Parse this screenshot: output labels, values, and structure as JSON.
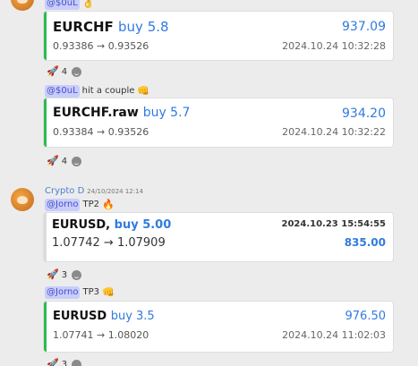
{
  "msg1": {
    "mention": "@$0uL",
    "card": {
      "pair": "EURCHF",
      "side": "buy 5.8",
      "profit": "937.09",
      "entry": "0.93386",
      "exit": "0.93526",
      "arrow": "→",
      "date": "2024.10.24 10:32:28"
    },
    "reactions": {
      "count": "4"
    }
  },
  "msg2": {
    "mention": "@$0uL",
    "text": "hit a couple",
    "card": {
      "pair": "EURCHF.raw",
      "side": "buy 5.7",
      "profit": "934.20",
      "entry": "0.93384",
      "exit": "0.93526",
      "arrow": "→",
      "date": "2024.10.24 10:32:22"
    },
    "reactions": {
      "count": "4"
    }
  },
  "msg3": {
    "username": "Crypto D",
    "timestamp": "24/10/2024 12:14",
    "mention": "@Jorno",
    "text": "TP2",
    "card": {
      "pair": "EURUSD,",
      "side": "buy 5.00",
      "profit": "835.00",
      "entry": "1.07742",
      "exit": "1.07909",
      "arrow": "→",
      "date": "2024.10.23 15:54:55"
    },
    "reactions": {
      "count": "3"
    }
  },
  "msg4": {
    "mention": "@Jorno",
    "text": "TP3",
    "card": {
      "pair": "EURUSD",
      "side": "buy 3.5",
      "profit": "976.50",
      "entry": "1.07741",
      "exit": "1.08020",
      "arrow": "→",
      "date": "2024.10.24 11:02:03"
    },
    "reactions": {
      "count": "3"
    }
  },
  "colors": {
    "accent": "#2f7be0",
    "border": "#2bbb50",
    "mention_bg": "#c9cdfb",
    "mention_fg": "#4450c7"
  },
  "icons": {
    "reaction_icon": "rocket-icon",
    "add_reaction": "smiley-icon"
  }
}
